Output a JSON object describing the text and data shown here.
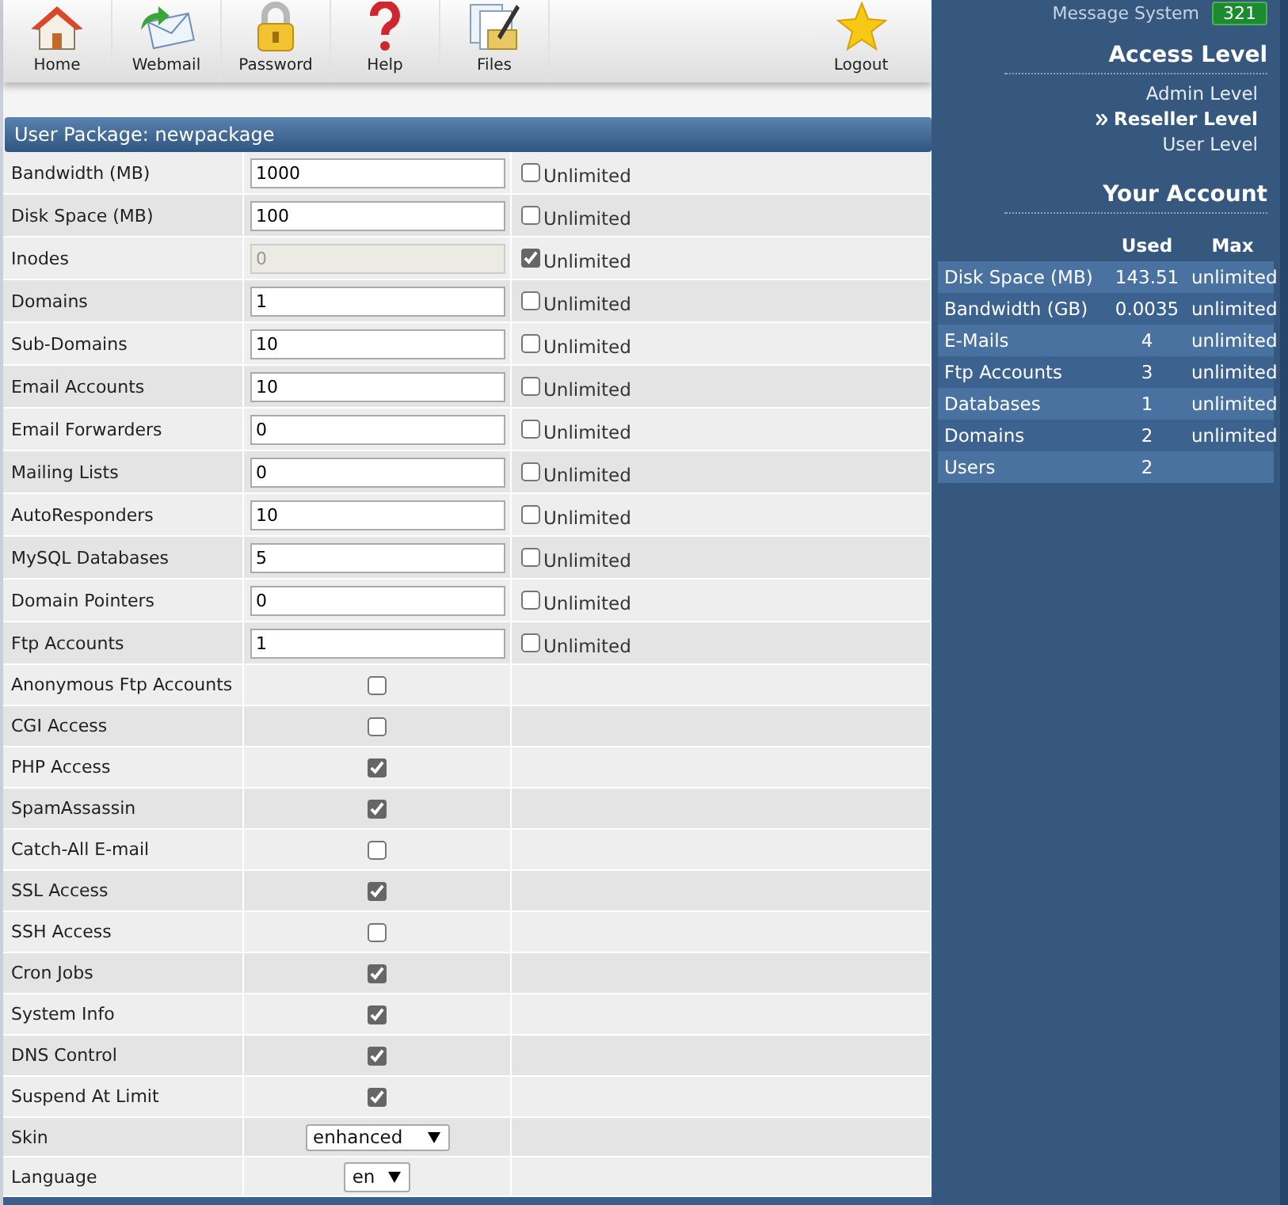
{
  "toolbar": [
    {
      "kind": "home",
      "label": "Home"
    },
    {
      "kind": "webmail",
      "label": "Webmail"
    },
    {
      "kind": "password",
      "label": "Password"
    },
    {
      "kind": "help",
      "label": "Help"
    },
    {
      "kind": "files",
      "label": "Files"
    },
    {
      "kind": "logout",
      "label": "Logout"
    }
  ],
  "package": {
    "title": "User Package: newpackage",
    "limits": [
      {
        "label": "Bandwidth (MB)",
        "value": "1000",
        "unlimited_label": "Unlimited",
        "unlimited": false
      },
      {
        "label": "Disk Space (MB)",
        "value": "100",
        "unlimited_label": "Unlimited",
        "unlimited": false
      },
      {
        "label": "Inodes",
        "value": "0",
        "unlimited_label": "Unlimited",
        "unlimited": true
      },
      {
        "label": "Domains",
        "value": "1",
        "unlimited_label": "Unlimited",
        "unlimited": false
      },
      {
        "label": "Sub-Domains",
        "value": "10",
        "unlimited_label": "Unlimited",
        "unlimited": false
      },
      {
        "label": "Email Accounts",
        "value": "10",
        "unlimited_label": "Unlimited",
        "unlimited": false
      },
      {
        "label": "Email Forwarders",
        "value": "0",
        "unlimited_label": "Unlimited",
        "unlimited": false
      },
      {
        "label": "Mailing Lists",
        "value": "0",
        "unlimited_label": "Unlimited",
        "unlimited": false
      },
      {
        "label": "AutoResponders",
        "value": "10",
        "unlimited_label": "Unlimited",
        "unlimited": false
      },
      {
        "label": "MySQL Databases",
        "value": "5",
        "unlimited_label": "Unlimited",
        "unlimited": false
      },
      {
        "label": "Domain Pointers",
        "value": "0",
        "unlimited_label": "Unlimited",
        "unlimited": false
      },
      {
        "label": "Ftp Accounts",
        "value": "1",
        "unlimited_label": "Unlimited",
        "unlimited": false
      }
    ],
    "features": [
      {
        "label": "Anonymous Ftp Accounts",
        "checked": false
      },
      {
        "label": "CGI Access",
        "checked": false
      },
      {
        "label": "PHP Access",
        "checked": true
      },
      {
        "label": "SpamAssassin",
        "checked": true
      },
      {
        "label": "Catch-All E-mail",
        "checked": false
      },
      {
        "label": "SSL Access",
        "checked": true
      },
      {
        "label": "SSH Access",
        "checked": false
      },
      {
        "label": "Cron Jobs",
        "checked": true
      },
      {
        "label": "System Info",
        "checked": true
      },
      {
        "label": "DNS Control",
        "checked": true
      },
      {
        "label": "Suspend At Limit",
        "checked": true
      }
    ],
    "selects": [
      {
        "label": "Skin",
        "value": "enhanced"
      },
      {
        "label": "Language",
        "value": "en"
      }
    ]
  },
  "sidebar": {
    "message_system": {
      "label": "Message System",
      "count": "321"
    },
    "access_level": {
      "title": "Access Level",
      "items": [
        {
          "label": "Admin Level",
          "selected": false
        },
        {
          "label": "Reseller Level",
          "selected": true
        },
        {
          "label": "User Level",
          "selected": false
        }
      ]
    },
    "account": {
      "title": "Your Account",
      "columns": [
        "Used",
        "Max"
      ],
      "rows": [
        {
          "label": "Disk Space (MB)",
          "used": "143.51",
          "max": "unlimited"
        },
        {
          "label": "Bandwidth (GB)",
          "used": "0.0035",
          "max": "unlimited"
        },
        {
          "label": "E-Mails",
          "used": "4",
          "max": "unlimited"
        },
        {
          "label": "Ftp Accounts",
          "used": "3",
          "max": "unlimited"
        },
        {
          "label": "Databases",
          "used": "1",
          "max": "unlimited"
        },
        {
          "label": "Domains",
          "used": "2",
          "max": "unlimited"
        },
        {
          "label": "Users",
          "used": "2"
        }
      ]
    }
  }
}
